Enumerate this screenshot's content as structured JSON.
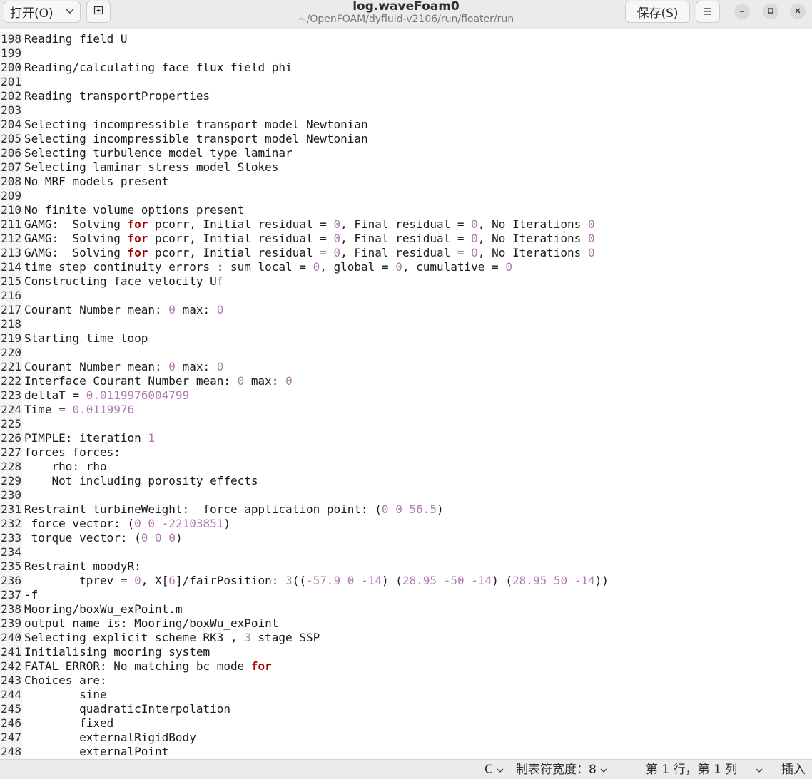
{
  "header": {
    "open_label": "打开(O)",
    "title": "log.waveFoam0",
    "path": "~/OpenFOAM/dyfluid-v2106/run/floater/run",
    "save_label": "保存(S)"
  },
  "icons": {
    "open_chevron": "chevron-down-icon",
    "pin": "new-tab-icon",
    "menu": "hamburger-menu-icon",
    "minimize": "minimize-icon",
    "maximize": "maximize-icon",
    "close": "close-icon"
  },
  "colors": {
    "number": "#b07ab0",
    "keyword": "#a40000"
  },
  "lines": [
    {
      "n": "198",
      "t": "Reading field U"
    },
    {
      "n": "199",
      "t": ""
    },
    {
      "n": "200",
      "t": "Reading/calculating face flux field phi"
    },
    {
      "n": "201",
      "t": ""
    },
    {
      "n": "202",
      "t": "Reading transportProperties"
    },
    {
      "n": "203",
      "t": ""
    },
    {
      "n": "204",
      "t": "Selecting incompressible transport model Newtonian"
    },
    {
      "n": "205",
      "t": "Selecting incompressible transport model Newtonian"
    },
    {
      "n": "206",
      "t": "Selecting turbulence model type laminar"
    },
    {
      "n": "207",
      "t": "Selecting laminar stress model Stokes"
    },
    {
      "n": "208",
      "t": "No MRF models present"
    },
    {
      "n": "209",
      "t": ""
    },
    {
      "n": "210",
      "t": "No finite volume options present"
    },
    {
      "n": "211",
      "t": "GAMG:  Solving for pcorr, Initial residual = 0, Final residual = 0, No Iterations 0"
    },
    {
      "n": "212",
      "t": "GAMG:  Solving for pcorr, Initial residual = 0, Final residual = 0, No Iterations 0"
    },
    {
      "n": "213",
      "t": "GAMG:  Solving for pcorr, Initial residual = 0, Final residual = 0, No Iterations 0"
    },
    {
      "n": "214",
      "t": "time step continuity errors : sum local = 0, global = 0, cumulative = 0"
    },
    {
      "n": "215",
      "t": "Constructing face velocity Uf"
    },
    {
      "n": "216",
      "t": ""
    },
    {
      "n": "217",
      "t": "Courant Number mean: 0 max: 0"
    },
    {
      "n": "218",
      "t": ""
    },
    {
      "n": "219",
      "t": "Starting time loop"
    },
    {
      "n": "220",
      "t": ""
    },
    {
      "n": "221",
      "t": "Courant Number mean: 0 max: 0"
    },
    {
      "n": "222",
      "t": "Interface Courant Number mean: 0 max: 0"
    },
    {
      "n": "223",
      "t": "deltaT = 0.0119976004799"
    },
    {
      "n": "224",
      "t": "Time = 0.0119976"
    },
    {
      "n": "225",
      "t": ""
    },
    {
      "n": "226",
      "t": "PIMPLE: iteration 1"
    },
    {
      "n": "227",
      "t": "forces forces:"
    },
    {
      "n": "228",
      "t": "    rho: rho"
    },
    {
      "n": "229",
      "t": "    Not including porosity effects"
    },
    {
      "n": "230",
      "t": ""
    },
    {
      "n": "231",
      "t": "Restraint turbineWeight:  force application point: (0 0 56.5)"
    },
    {
      "n": "232",
      "t": " force vector: (0 0 -22103851)"
    },
    {
      "n": "233",
      "t": " torque vector: (0 0 0)"
    },
    {
      "n": "234",
      "t": ""
    },
    {
      "n": "235",
      "t": "Restraint moodyR:"
    },
    {
      "n": "236",
      "t": "        tprev = 0, X[6]/fairPosition: 3((-57.9 0 -14) (28.95 -50 -14) (28.95 50 -14))"
    },
    {
      "n": "237",
      "t": "-f"
    },
    {
      "n": "238",
      "t": "Mooring/boxWu_exPoint.m"
    },
    {
      "n": "239",
      "t": "output name is: Mooring/boxWu_exPoint"
    },
    {
      "n": "240",
      "t": "Selecting explicit scheme RK3 , 3 stage SSP"
    },
    {
      "n": "241",
      "t": "Initialising mooring system"
    },
    {
      "n": "242",
      "t": "FATAL ERROR: No matching bc mode for"
    },
    {
      "n": "243",
      "t": "Choices are:"
    },
    {
      "n": "244",
      "t": "        sine"
    },
    {
      "n": "245",
      "t": "        quadraticInterpolation"
    },
    {
      "n": "246",
      "t": "        fixed"
    },
    {
      "n": "247",
      "t": "        externalRigidBody"
    },
    {
      "n": "248",
      "t": "        externalPoint"
    }
  ],
  "status": {
    "language": "C",
    "tab_width": "制表符宽度：8",
    "position": "第 1 行，第 1 列",
    "mode": "插入"
  }
}
